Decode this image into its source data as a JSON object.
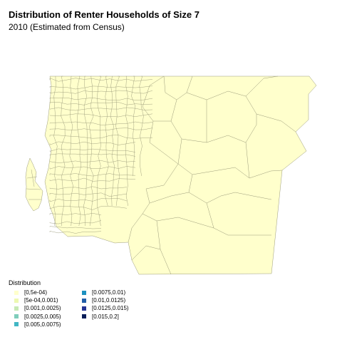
{
  "title": "Distribution of Renter Households of Size 7",
  "subtitle": "2010 (Estimated from Census)",
  "legend": {
    "title": "Distribution",
    "items": [
      {
        "label": "[0,5e-04)",
        "color": "#ffffcc"
      },
      {
        "label": "[5e-04,0.001)",
        "color": "#edf8b1"
      },
      {
        "label": "[0.001,0.0025)",
        "color": "#c7e9b4"
      },
      {
        "label": "[0.0025,0.005)",
        "color": "#7fcdbb"
      },
      {
        "label": "[0.005,0.0075)",
        "color": "#41b6c4"
      },
      {
        "label": "[0.0075,0.01)",
        "color": "#1d91c0"
      },
      {
        "label": "[0.01,0.0125)",
        "color": "#225ea8"
      },
      {
        "label": "[0.0125,0.015)",
        "color": "#253494"
      },
      {
        "label": "[0.015,0.2]",
        "color": "#081d58"
      }
    ]
  },
  "map": {
    "region_fill": "#ffffcc",
    "border_color": "#9a9a7a"
  }
}
